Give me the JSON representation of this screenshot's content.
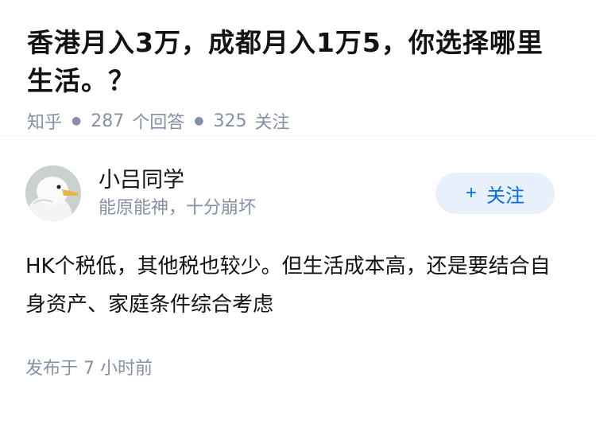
{
  "question": {
    "title": "香港月入3万，成都月入1万5，你选择哪里生活。？",
    "source": "知乎",
    "answers_count": "287",
    "answers_label": "个回答",
    "followers_count": "325",
    "followers_label": "关注"
  },
  "author": {
    "name": "小吕同学",
    "bio": "能原能神，十分崩坏",
    "follow_label": "关注",
    "follow_icon": "plus-icon"
  },
  "answer": {
    "text": "HK个税低，其他税也较少。但生活成本高，还是要结合自身资产、家庭条件综合考虑",
    "time_prefix": "发布于",
    "time_value": "7 小时前"
  },
  "colors": {
    "accent": "#056de8",
    "muted": "#8590a6",
    "button_bg": "#e8f1fb"
  }
}
